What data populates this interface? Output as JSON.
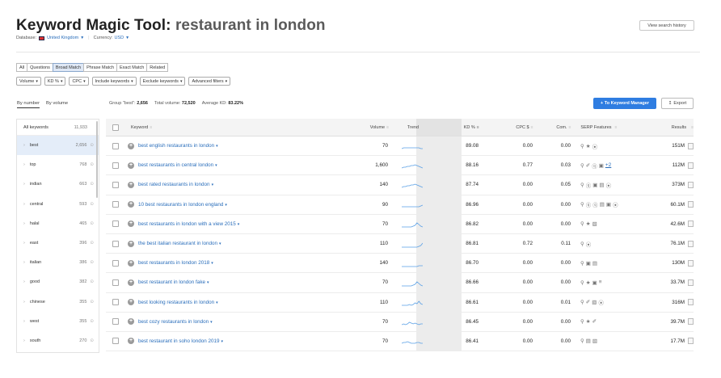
{
  "header": {
    "title_prefix": "Keyword Magic Tool: ",
    "title_query": "restaurant in london",
    "database_label": "Database:",
    "database_value": "United Kingdom",
    "currency_label": "Currency:",
    "currency_value": "USD",
    "history_button": "View search history"
  },
  "match_tabs": [
    "All",
    "Questions",
    "Broad Match",
    "Phrase Match",
    "Exact Match",
    "Related"
  ],
  "match_active": "Broad Match",
  "filters": [
    "Volume",
    "KD %",
    "CPC",
    "Include keywords",
    "Exclude keywords",
    "Advanced filters"
  ],
  "sort_tabs": {
    "by_number": "By number",
    "by_volume": "By volume"
  },
  "summary": {
    "group_label": "Group \"best\":",
    "group_value": "2,656",
    "volume_label": "Total volume:",
    "volume_value": "72,520",
    "kd_label": "Average KD:",
    "kd_value": "83.22%"
  },
  "actions": {
    "keyword_manager": "+ To Keyword Manager",
    "export": "Export"
  },
  "groups": {
    "all_label": "All keywords",
    "all_count": "11,933",
    "items": [
      {
        "label": "best",
        "count": "2,656",
        "selected": true
      },
      {
        "label": "top",
        "count": "768"
      },
      {
        "label": "indian",
        "count": "663"
      },
      {
        "label": "central",
        "count": "593"
      },
      {
        "label": "halal",
        "count": "465"
      },
      {
        "label": "east",
        "count": "396"
      },
      {
        "label": "italian",
        "count": "386"
      },
      {
        "label": "good",
        "count": "382"
      },
      {
        "label": "chinese",
        "count": "355"
      },
      {
        "label": "west",
        "count": "355"
      },
      {
        "label": "south",
        "count": "270"
      },
      {
        "label": "north",
        "count": "263"
      }
    ]
  },
  "columns": {
    "keyword": "Keyword",
    "volume": "Volume",
    "trend": "Trend",
    "kd": "KD %",
    "cpc": "CPC $",
    "com": "Com.",
    "serp": "SERP Features",
    "results": "Results"
  },
  "rows": [
    {
      "keyword": "best english restaurants in london",
      "volume": "70",
      "kd": "89.08",
      "cpc": "0.00",
      "com": "0.00",
      "serp": [
        "pin",
        "star",
        "circle-play"
      ],
      "results": "151M",
      "trend": [
        8,
        7,
        7,
        7,
        7,
        7,
        7,
        7,
        7,
        7,
        8,
        8
      ]
    },
    {
      "keyword": "best restaurants in central london",
      "volume": "1,600",
      "kd": "88.16",
      "cpc": "0.77",
      "com": "0.03",
      "serp": [
        "pin",
        "link",
        "q",
        "square",
        "+2"
      ],
      "results": "112M",
      "trend": [
        8,
        7,
        7,
        6,
        6,
        5,
        5,
        4,
        5,
        6,
        7,
        8
      ]
    },
    {
      "keyword": "best rated restaurants in london",
      "volume": "140",
      "kd": "87.74",
      "cpc": "0.00",
      "com": "0.05",
      "serp": [
        "pin",
        "q",
        "square",
        "chat",
        "circle-play"
      ],
      "results": "373M",
      "trend": [
        8,
        7,
        7,
        6,
        6,
        5,
        5,
        4,
        5,
        6,
        7,
        8
      ]
    },
    {
      "keyword": "10 best restaurants in london england",
      "volume": "90",
      "kd": "86.96",
      "cpc": "0.00",
      "com": "0.00",
      "serp": [
        "pin",
        "q",
        "q",
        "chat",
        "square",
        "circle-play"
      ],
      "results": "60.1M",
      "trend": [
        8,
        8,
        8,
        8,
        8,
        8,
        8,
        8,
        8,
        8,
        7,
        6
      ]
    },
    {
      "keyword": "best restaurants in london with a view 2015",
      "volume": "70",
      "kd": "86.82",
      "cpc": "0.00",
      "com": "0.00",
      "serp": [
        "pin",
        "star",
        "image"
      ],
      "results": "42.6M",
      "trend": [
        9,
        9,
        9,
        9,
        9,
        9,
        8,
        7,
        4,
        6,
        8,
        9
      ]
    },
    {
      "keyword": "the best italian restaurant in london",
      "volume": "110",
      "kd": "86.81",
      "cpc": "0.72",
      "com": "0.11",
      "serp": [
        "pin",
        "circle-play"
      ],
      "results": "76.1M",
      "trend": [
        9,
        9,
        9,
        9,
        9,
        9,
        9,
        9,
        9,
        8,
        7,
        4
      ]
    },
    {
      "keyword": "best restaurants in london 2018",
      "volume": "140",
      "kd": "86.70",
      "cpc": "0.00",
      "com": "0.00",
      "serp": [
        "pin",
        "square",
        "chat"
      ],
      "results": "130M",
      "trend": [
        9,
        9,
        9,
        9,
        9,
        9,
        9,
        9,
        9,
        8,
        8,
        8
      ]
    },
    {
      "keyword": "best restaurant in london fake",
      "volume": "70",
      "kd": "86.66",
      "cpc": "0.00",
      "com": "0.00",
      "serp": [
        "pin",
        "star",
        "square",
        "feed"
      ],
      "results": "33.7M",
      "trend": [
        9,
        9,
        9,
        9,
        9,
        9,
        8,
        7,
        4,
        6,
        8,
        9
      ]
    },
    {
      "keyword": "best looking restaurants in london",
      "volume": "110",
      "kd": "86.61",
      "cpc": "0.00",
      "com": "0.01",
      "serp": [
        "pin",
        "link",
        "image",
        "circle-play"
      ],
      "results": "316M",
      "trend": [
        9,
        9,
        9,
        9,
        8,
        9,
        8,
        6,
        7,
        4,
        7,
        8
      ]
    },
    {
      "keyword": "best cozy restaurants in london",
      "volume": "70",
      "kd": "86.45",
      "cpc": "0.00",
      "com": "0.00",
      "serp": [
        "pin",
        "star",
        "link"
      ],
      "results": "39.7M",
      "trend": [
        9,
        8,
        9,
        8,
        6,
        7,
        8,
        7,
        8,
        9,
        8,
        8
      ]
    },
    {
      "keyword": "best restaurant in soho london 2019",
      "volume": "70",
      "kd": "86.41",
      "cpc": "0.00",
      "com": "0.00",
      "serp": [
        "pin",
        "chat",
        "image"
      ],
      "results": "17.7M",
      "trend": [
        8,
        7,
        7,
        6,
        7,
        8,
        8,
        8,
        7,
        7,
        8,
        8
      ]
    }
  ],
  "colors": {
    "accent": "#2f7de1",
    "link": "#2a6ebb",
    "kd_column": "#ececec",
    "selected_group": "#e4edf9"
  }
}
